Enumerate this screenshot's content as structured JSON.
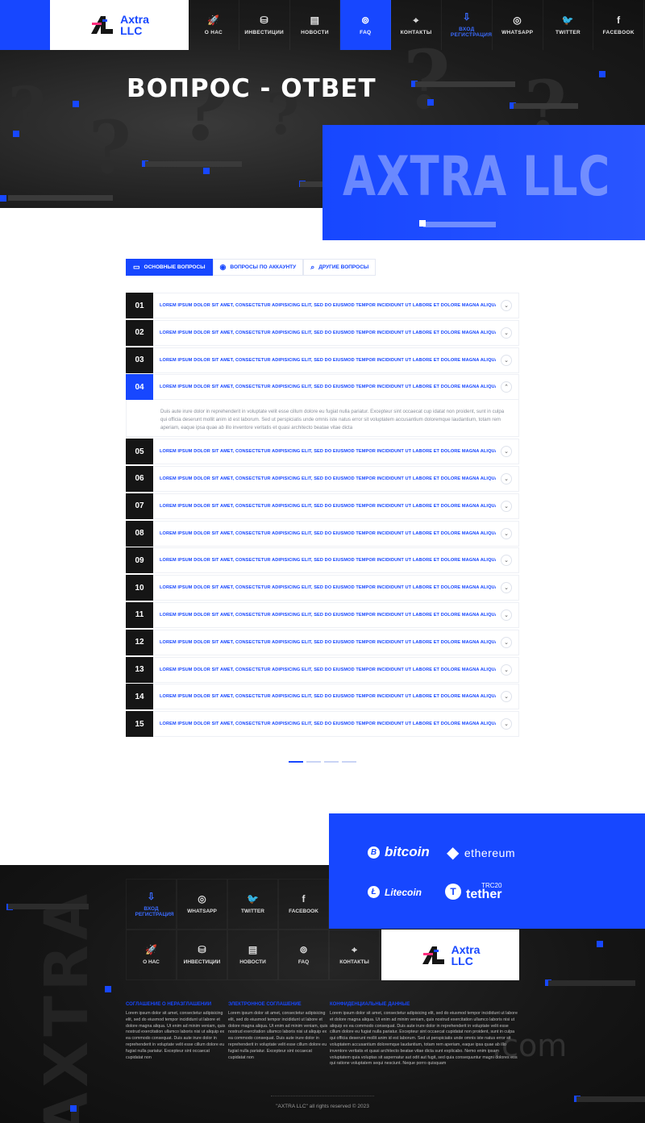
{
  "brand": {
    "name_line1": "Axtra",
    "name_line2": "LLC",
    "hero_big": "AXTRA LLC",
    "footer_vertical": "AXTRA"
  },
  "nav": [
    {
      "label": "О НАС",
      "icon": "rocket-icon",
      "glyph": "🚀"
    },
    {
      "label": "ИНВЕСТИЦИИ",
      "icon": "coins-icon",
      "glyph": "⛁"
    },
    {
      "label": "НОВОСТИ",
      "icon": "news-icon",
      "glyph": "▤"
    },
    {
      "label": "FAQ",
      "icon": "lifebuoy-icon",
      "glyph": "⊚"
    },
    {
      "label": "КОНТАКТЫ",
      "icon": "location-icon",
      "glyph": "⌖"
    },
    {
      "label": "ВХОД РЕГИСТРАЦИЯ",
      "icon": "login-icon",
      "glyph": "⇩"
    },
    {
      "label": "WHATSAPP",
      "icon": "whatsapp-icon",
      "glyph": "◎"
    },
    {
      "label": "TWITTER",
      "icon": "twitter-icon",
      "glyph": "🐦"
    },
    {
      "label": "FACEBOOK",
      "icon": "facebook-icon",
      "glyph": "f"
    }
  ],
  "hero": {
    "title": "ВОПРОС - ОТВЕТ"
  },
  "tabs": [
    {
      "label": "ОСНОВНЫЕ ВОПРОСЫ",
      "icon": "chat-icon",
      "glyph": "▭"
    },
    {
      "label": "ВОПРОСЫ ПО АККАУНТУ",
      "icon": "user-icon",
      "glyph": "◉"
    },
    {
      "label": "ДРУГИЕ ВОПРОСЫ",
      "icon": "search-icon",
      "glyph": "⌕"
    }
  ],
  "faq": {
    "question": "LOREM IPSUM DOLOR SIT AMET, CONSECTETUR ADIPISICING ELIT, SED DO EIUSMOD TEMPOR INCIDIDUNT UT LABORE ET DOLORE MAGNA ALIQUA.",
    "answer": "Duis aute irure dolor in reprehenderit in voluptate velit esse cillum dolore eu fugiat nulla pariatur. Excepteur sint occaecat cup idatat non proident, sunt in culpa qui officia deserunt mollit anim id est laborum. Sed ut perspiciatis unde omnis iste natus error sit voluptatem accusantium doloremque laudantium, totam rem aperiam, eaque ipsa quae ab illo inventore veritatis et quasi architecto beatae vitae dicta",
    "numbers": [
      "01",
      "02",
      "03",
      "04",
      "05",
      "06",
      "07",
      "08",
      "09",
      "10",
      "11",
      "12",
      "13",
      "14",
      "15"
    ],
    "open_index": 3
  },
  "crypto": {
    "bitcoin": "bitcoin",
    "ethereum": "ethereum",
    "litecoin": "Litecoin",
    "tether": "tether",
    "tether_tag": "TRC20"
  },
  "footer_nav_row1": [
    {
      "label": "ВХОД РЕГИСТРАЦИЯ",
      "icon": "login-icon",
      "glyph": "⇩"
    },
    {
      "label": "WHATSAPP",
      "icon": "whatsapp-icon",
      "glyph": "◎"
    },
    {
      "label": "TWITTER",
      "icon": "twitter-icon",
      "glyph": "🐦"
    },
    {
      "label": "FACEBOOK",
      "icon": "facebook-icon",
      "glyph": "f"
    }
  ],
  "footer_nav_row2": [
    {
      "label": "О НАС",
      "icon": "rocket-icon",
      "glyph": "🚀"
    },
    {
      "label": "ИНВЕСТИЦИИ",
      "icon": "coins-icon",
      "glyph": "⛁"
    },
    {
      "label": "НОВОСТИ",
      "icon": "news-icon",
      "glyph": "▤"
    },
    {
      "label": "FAQ",
      "icon": "lifebuoy-icon",
      "glyph": "⊚"
    },
    {
      "label": "КОНТАКТЫ",
      "icon": "location-icon",
      "glyph": "⌖"
    }
  ],
  "footer_cols": [
    {
      "title": "СОГЛАШЕНИЕ О НЕРАЗГЛАШЕНИИ",
      "text": "Lorem ipsum dolor sit amet, consectetur adipisicing elit, sed do eiusmod tempor incididunt ut labore et dolore magna aliqua. Ut enim ad minim veniam, quis nostrud exercitation ullamco laboris nisi ut aliquip ex ea commodo consequat. Duis aute irure dolor in reprehenderit in voluptate velit esse cillum dolore eu fugiat nulla pariatur. Excepteur sint occaecat cupidatat non"
    },
    {
      "title": "ЭЛЕКТРОННОЕ СОГЛАШЕНИЕ",
      "text": "Lorem ipsum dolor sit amet, consectetur adipisicing elit, sed do eiusmod tempor incididunt ut labore et dolore magna aliqua. Ut enim ad minim veniam, quis nostrud exercitation ullamco laboris nisi ut aliquip ex ea commodo consequat. Duis aute irure dolor in reprehenderit in voluptate velit esse cillum dolore eu fugiat nulla pariatur. Excepteur sint occaecat cupidatat non"
    },
    {
      "title": "КОНФИДЕНЦИАЛЬНЫЕ ДАННЫЕ",
      "text": "Lorem ipsum dolor sit amet, consectetur adipisicing elit, sed do eiusmod tempor incididunt ut labore et dolore magna aliqua. Ut enim ad minim veniam, quis nostrud exercitation ullamco laboris nisi ut aliquip ex ea commodo consequat. Duis aute irure dolor in reprehenderit in voluptate velit esse cillum dolore eu fugiat nulla pariatur. Excepteur sint occaecat cupidatat non proident, sunt in culpa qui officia deserunt mollit anim id est laborum. Sed ut perspiciatis unde omnis iste natus error sit voluptatem accusantium doloremque laudantium, totam rem aperiam, eaque ipsa quae ab illo inventore veritatis et quasi architecto beatae vitae dicta sunt explicabo. Nemo enim ipsam voluptatem quia voluptas sit aspernatur aut odit aut fugit, sed quia consequuntur magni dolores eos qui ratione voluptatem sequi nesciunt. Neque porro quisquam"
    }
  ],
  "watermark": ".com",
  "copyright": "\"AXTRA LLC\" all rights reserved © 2023",
  "colors": {
    "accent": "#1747ff",
    "dark": "#151515"
  }
}
